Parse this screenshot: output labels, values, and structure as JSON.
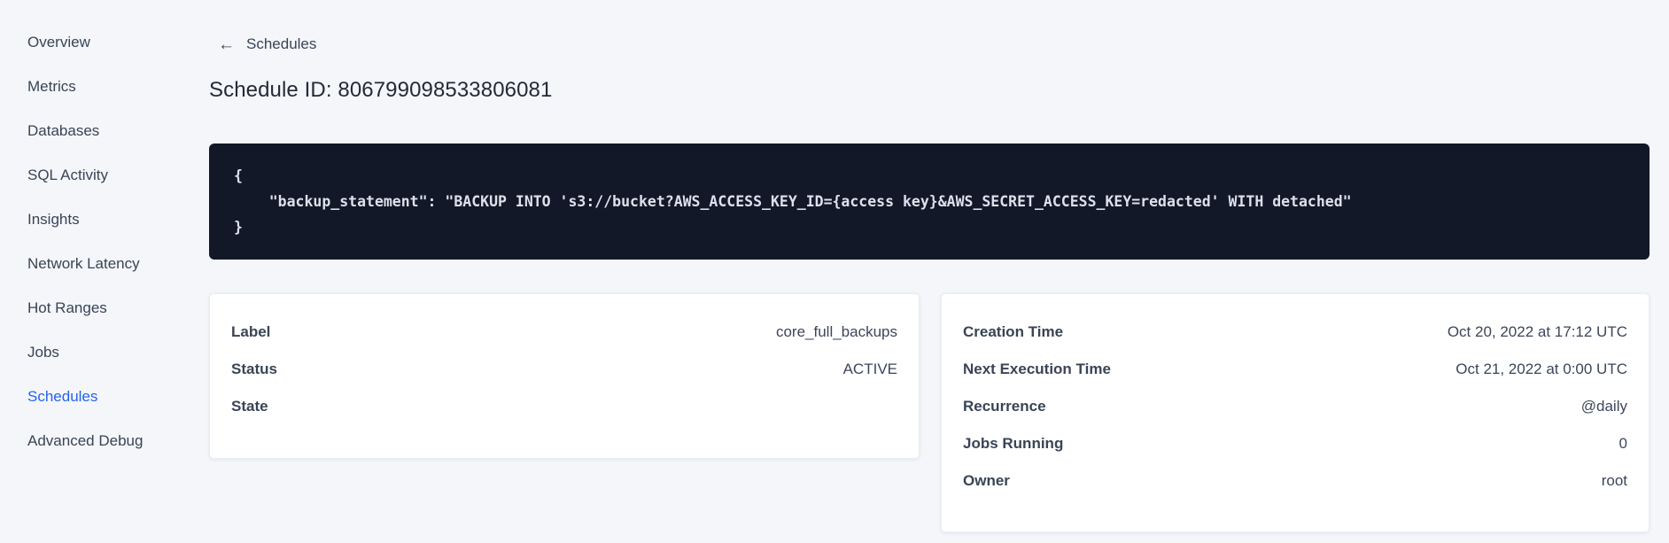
{
  "sidebar": {
    "items": [
      {
        "label": "Overview",
        "active": false
      },
      {
        "label": "Metrics",
        "active": false
      },
      {
        "label": "Databases",
        "active": false
      },
      {
        "label": "SQL Activity",
        "active": false
      },
      {
        "label": "Insights",
        "active": false
      },
      {
        "label": "Network Latency",
        "active": false
      },
      {
        "label": "Hot Ranges",
        "active": false
      },
      {
        "label": "Jobs",
        "active": false
      },
      {
        "label": "Schedules",
        "active": true
      },
      {
        "label": "Advanced Debug",
        "active": false
      }
    ],
    "active_color": "#2563eb",
    "text_color": "#394455"
  },
  "header": {
    "back_icon": "←",
    "back_label": "Schedules",
    "title": "Schedule ID: 806799098533806081"
  },
  "code_block": {
    "background": "#121828",
    "text_color": "#dce1ea",
    "lines": [
      "{",
      "    \"backup_statement\": \"BACKUP INTO 's3://bucket?AWS_ACCESS_KEY_ID={access key}&AWS_SECRET_ACCESS_KEY=redacted' WITH detached\"",
      "}"
    ]
  },
  "details_left": {
    "rows": [
      {
        "label": "Label",
        "value": "core_full_backups"
      },
      {
        "label": "Status",
        "value": "ACTIVE"
      },
      {
        "label": "State",
        "value": ""
      }
    ]
  },
  "details_right": {
    "rows": [
      {
        "label": "Creation Time",
        "value": "Oct 20, 2022 at 17:12 UTC"
      },
      {
        "label": "Next Execution Time",
        "value": "Oct 21, 2022 at 0:00 UTC"
      },
      {
        "label": "Recurrence",
        "value": "@daily"
      },
      {
        "label": "Jobs Running",
        "value": "0"
      },
      {
        "label": "Owner",
        "value": "root"
      }
    ]
  }
}
